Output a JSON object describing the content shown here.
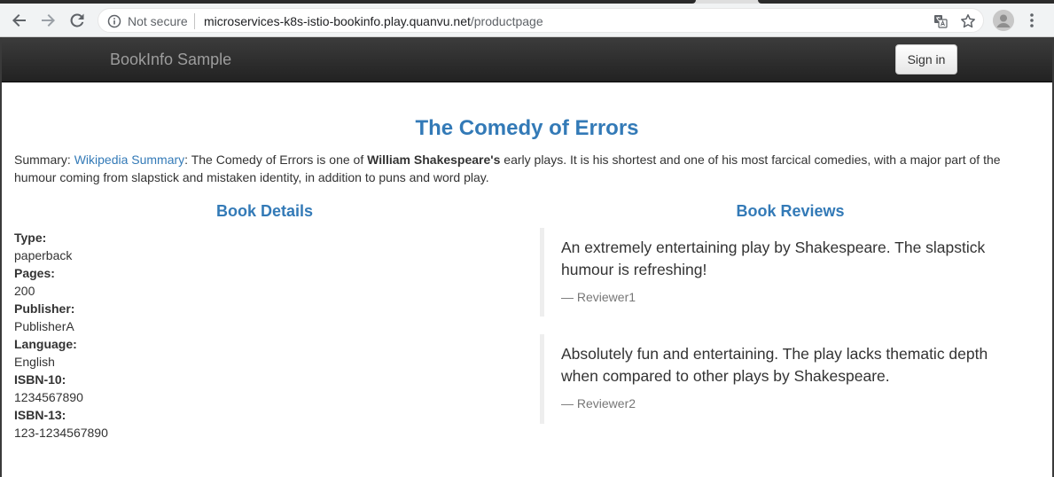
{
  "browser": {
    "security_label": "Not secure",
    "url_host": "microservices-k8s-istio-bookinfo.play.quanvu.net",
    "url_path": "/productpage"
  },
  "navbar": {
    "brand": "BookInfo Sample",
    "signin_label": "Sign in"
  },
  "book": {
    "title": "The Comedy of Errors",
    "summary_prefix": "Summary: ",
    "summary_link": "Wikipedia Summary",
    "summary_text_1": ": The Comedy of Errors is one of ",
    "summary_bold": "William Shakespeare's",
    "summary_text_2": " early plays. It is his shortest and one of his most farcical comedies, with a major part of the humour coming from slapstick and mistaken identity, in addition to puns and word play."
  },
  "details": {
    "heading": "Book Details",
    "items": [
      {
        "label": "Type:",
        "value": "paperback"
      },
      {
        "label": "Pages:",
        "value": "200"
      },
      {
        "label": "Publisher:",
        "value": "PublisherA"
      },
      {
        "label": "Language:",
        "value": "English"
      },
      {
        "label": "ISBN-10:",
        "value": "1234567890"
      },
      {
        "label": "ISBN-13:",
        "value": "123-1234567890"
      }
    ]
  },
  "reviews": {
    "heading": "Book Reviews",
    "items": [
      {
        "text": "An extremely entertaining play by Shakespeare. The slapstick humour is refreshing!",
        "reviewer": "— Reviewer1"
      },
      {
        "text": "Absolutely fun and entertaining. The play lacks thematic depth when compared to other plays by Shakespeare.",
        "reviewer": "— Reviewer2"
      }
    ]
  },
  "icons": {
    "back": "back-arrow-icon",
    "forward": "forward-arrow-icon",
    "reload": "reload-icon",
    "info": "info-icon",
    "translate": "translate-icon",
    "star": "star-icon",
    "profile": "profile-avatar-icon",
    "menu": "menu-dots-icon"
  },
  "colors": {
    "link": "#337ab7",
    "navbar": "#222222",
    "brand": "#9d9d9d"
  }
}
